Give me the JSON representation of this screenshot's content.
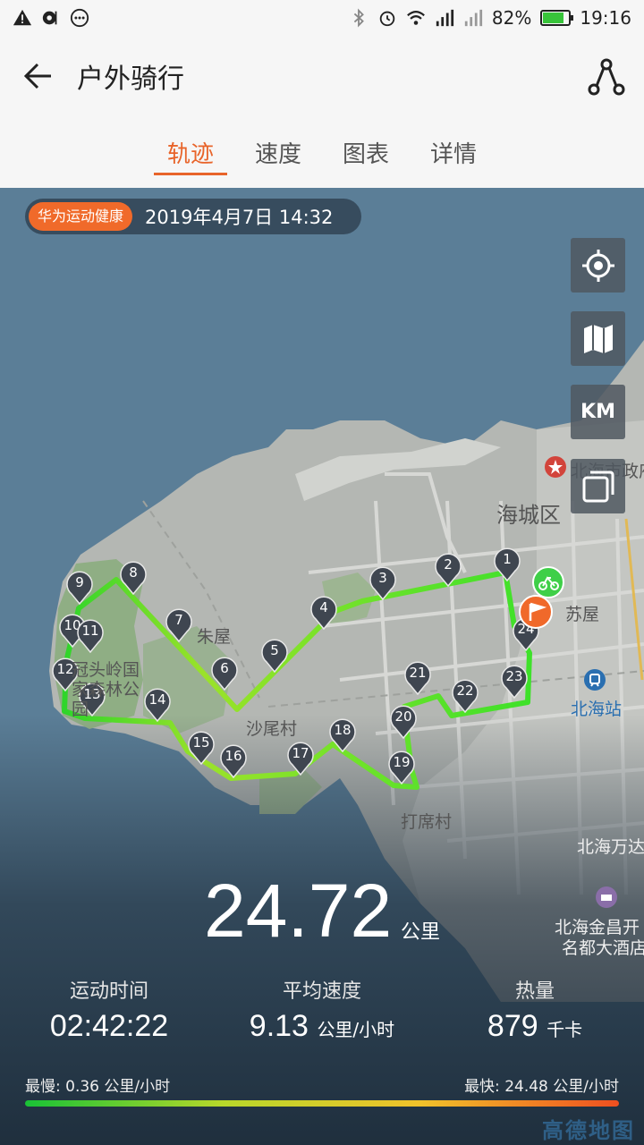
{
  "status": {
    "battery_pct": "82%",
    "time": "19:16",
    "battery_level": 0.82
  },
  "header": {
    "title": "户外骑行"
  },
  "tabs": [
    {
      "label": "轨迹"
    },
    {
      "label": "速度"
    },
    {
      "label": "图表"
    },
    {
      "label": "详情"
    }
  ],
  "map": {
    "brand": "华为运动健康",
    "datetime": "2019年4月7日 14:32",
    "km_button": "KM",
    "labels": {
      "haicheng": "海城区",
      "government": "北海市政府",
      "zhuwu": "朱屋",
      "park": "冠头岭国家森林公园",
      "shaweicun": "沙尾村",
      "suwu": "苏屋",
      "beihai_station": "北海站",
      "daxicun": "打席村",
      "wanda": "北海万达",
      "hotel1": "北海金昌开",
      "hotel2": "名都大酒店"
    },
    "markers": [
      "1",
      "2",
      "3",
      "4",
      "5",
      "6",
      "7",
      "8",
      "9",
      "10",
      "11",
      "12",
      "13",
      "14",
      "15",
      "16",
      "17",
      "18",
      "19",
      "20",
      "21",
      "22",
      "23",
      "24"
    ],
    "provider": "高德地图"
  },
  "stats": {
    "distance": "24.72",
    "distance_unit": "公里",
    "time_label": "运动时间",
    "time_value": "02:42:22",
    "speed_label": "平均速度",
    "speed_value": "9.13",
    "speed_unit": "公里/小时",
    "cal_label": "热量",
    "cal_value": "879",
    "cal_unit": "千卡",
    "slowest": "最慢:  0.36 公里/小时",
    "fastest": "最快:  24.48 公里/小时"
  },
  "colors": {
    "accent": "#e8642a",
    "track": "#4ee12a",
    "sea": "#5b7e97"
  }
}
